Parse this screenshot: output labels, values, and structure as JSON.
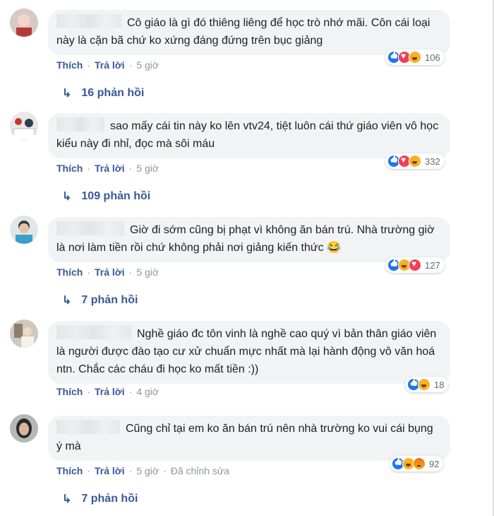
{
  "colors": {
    "link": "#385898",
    "muted": "#90949c",
    "bubble": "#f2f3f5",
    "like": "#1877f2",
    "love": "#f33e58",
    "haha": "#f7b125"
  },
  "comments": [
    {
      "text": "Cô giáo là gì đó thiêng liêng để học trò nhớ mãi. Côn cái loại này là cặn bã chứ ko xứng đáng đứng trên bục giảng",
      "reactions": [
        "like-icon",
        "love-icon",
        "haha-icon"
      ],
      "reaction_count": "106",
      "actions": {
        "like": "Thích",
        "reply": "Trả lời",
        "time": "5 giờ"
      },
      "replies": "16 phản hồi"
    },
    {
      "text": "sao mấy cái tin này ko lên vtv24, tiệt luôn cái thứ giáo viên vô học kiểu này đi nhỉ, đọc mà sôi máu",
      "reactions": [
        "like-icon",
        "love-icon",
        "haha-icon"
      ],
      "reaction_count": "332",
      "actions": {
        "like": "Thích",
        "reply": "Trả lời",
        "time": "5 giờ"
      },
      "replies": "109 phản hồi"
    },
    {
      "text": "Giờ đi sớm cũng bị phạt vì không ăn bán trú. Nhà trường giờ là nơi làm tiền rồi chứ không phải nơi giảng kiến thức 😂",
      "reactions": [
        "like-icon",
        "haha-icon",
        "love-icon"
      ],
      "reaction_count": "127",
      "actions": {
        "like": "Thích",
        "reply": "Trả lời",
        "time": "5 giờ"
      },
      "replies": "7 phản hồi"
    },
    {
      "text": "Nghề giáo đc tôn vinh là nghề cao quý vì bản thân giáo viên là người được đào tạo cư xử chuẩn mực nhất mà lại hành động vô văn hoá ntn. Chắc các cháu đi học ko mất tiền :))",
      "reactions": [
        "like-icon",
        "haha-icon"
      ],
      "reaction_count": "18",
      "actions": {
        "like": "Thích",
        "reply": "Trả lời",
        "time": "4 giờ"
      }
    },
    {
      "text": "Cũng chỉ tại em ko ăn bán trú nên nhà trường ko vui cái bụng ý mà",
      "reactions": [
        "like-icon",
        "haha-icon",
        "angry-icon"
      ],
      "reaction_count": "92",
      "actions": {
        "like": "Thích",
        "reply": "Trả lời",
        "time": "5 giờ",
        "edited": "Đã chỉnh sửa"
      },
      "replies": "7 phản hồi"
    }
  ]
}
